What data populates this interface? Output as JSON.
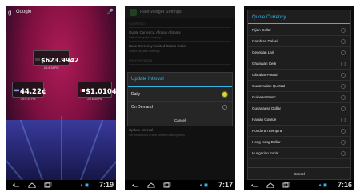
{
  "screen1": {
    "search_label": "Google",
    "widgets": [
      {
        "value": "$623.9942",
        "timestamp": "2/6 6:34 PM"
      },
      {
        "value": "44.22¢",
        "timestamp": "2/6 6:34 PM"
      },
      {
        "value": "$1.0104",
        "timestamp": "2/6 6:34 PM"
      }
    ],
    "clock": "7:19"
  },
  "screen2": {
    "title": "Rate Widget Settings",
    "section_currency": "CURRENCY",
    "quote_title": "Quote Currency: Afghan Afghani",
    "quote_summary": "Select the quote currency",
    "base_title": "Base Currency: United States Dollar",
    "base_summary": "Select the base currency",
    "section_preferences": "PREFERENCES",
    "interval_title": "Update interval",
    "interval_summary": "Set the amount of time between rate updates",
    "dialog_title": "Update Interval",
    "options": [
      "Daily",
      "On Demand"
    ],
    "selected_option": "Daily",
    "cancel": "Cancel",
    "clock": "7:17"
  },
  "screen3": {
    "dialog_title": "Quote Currency",
    "currencies": [
      "Fijian Dollar",
      "Gambian Dalasi",
      "Georgian Lari",
      "Ghanaian Cedi",
      "Gibraltar Pound",
      "Guatemalan Quetzal",
      "Guinean Franc",
      "Guyanaese Dollar",
      "Haitian Gourde",
      "Honduran Lempira",
      "Hong Kong Dollar",
      "Hungarian Forint"
    ],
    "cancel": "Cancel",
    "clock": "7:16"
  },
  "colors": {
    "accent": "#33b5e5",
    "radio_selected": "#d7d730"
  },
  "icons": [
    "back-icon",
    "home-icon",
    "recent-apps-icon",
    "google-g-icon",
    "mic-icon"
  ]
}
